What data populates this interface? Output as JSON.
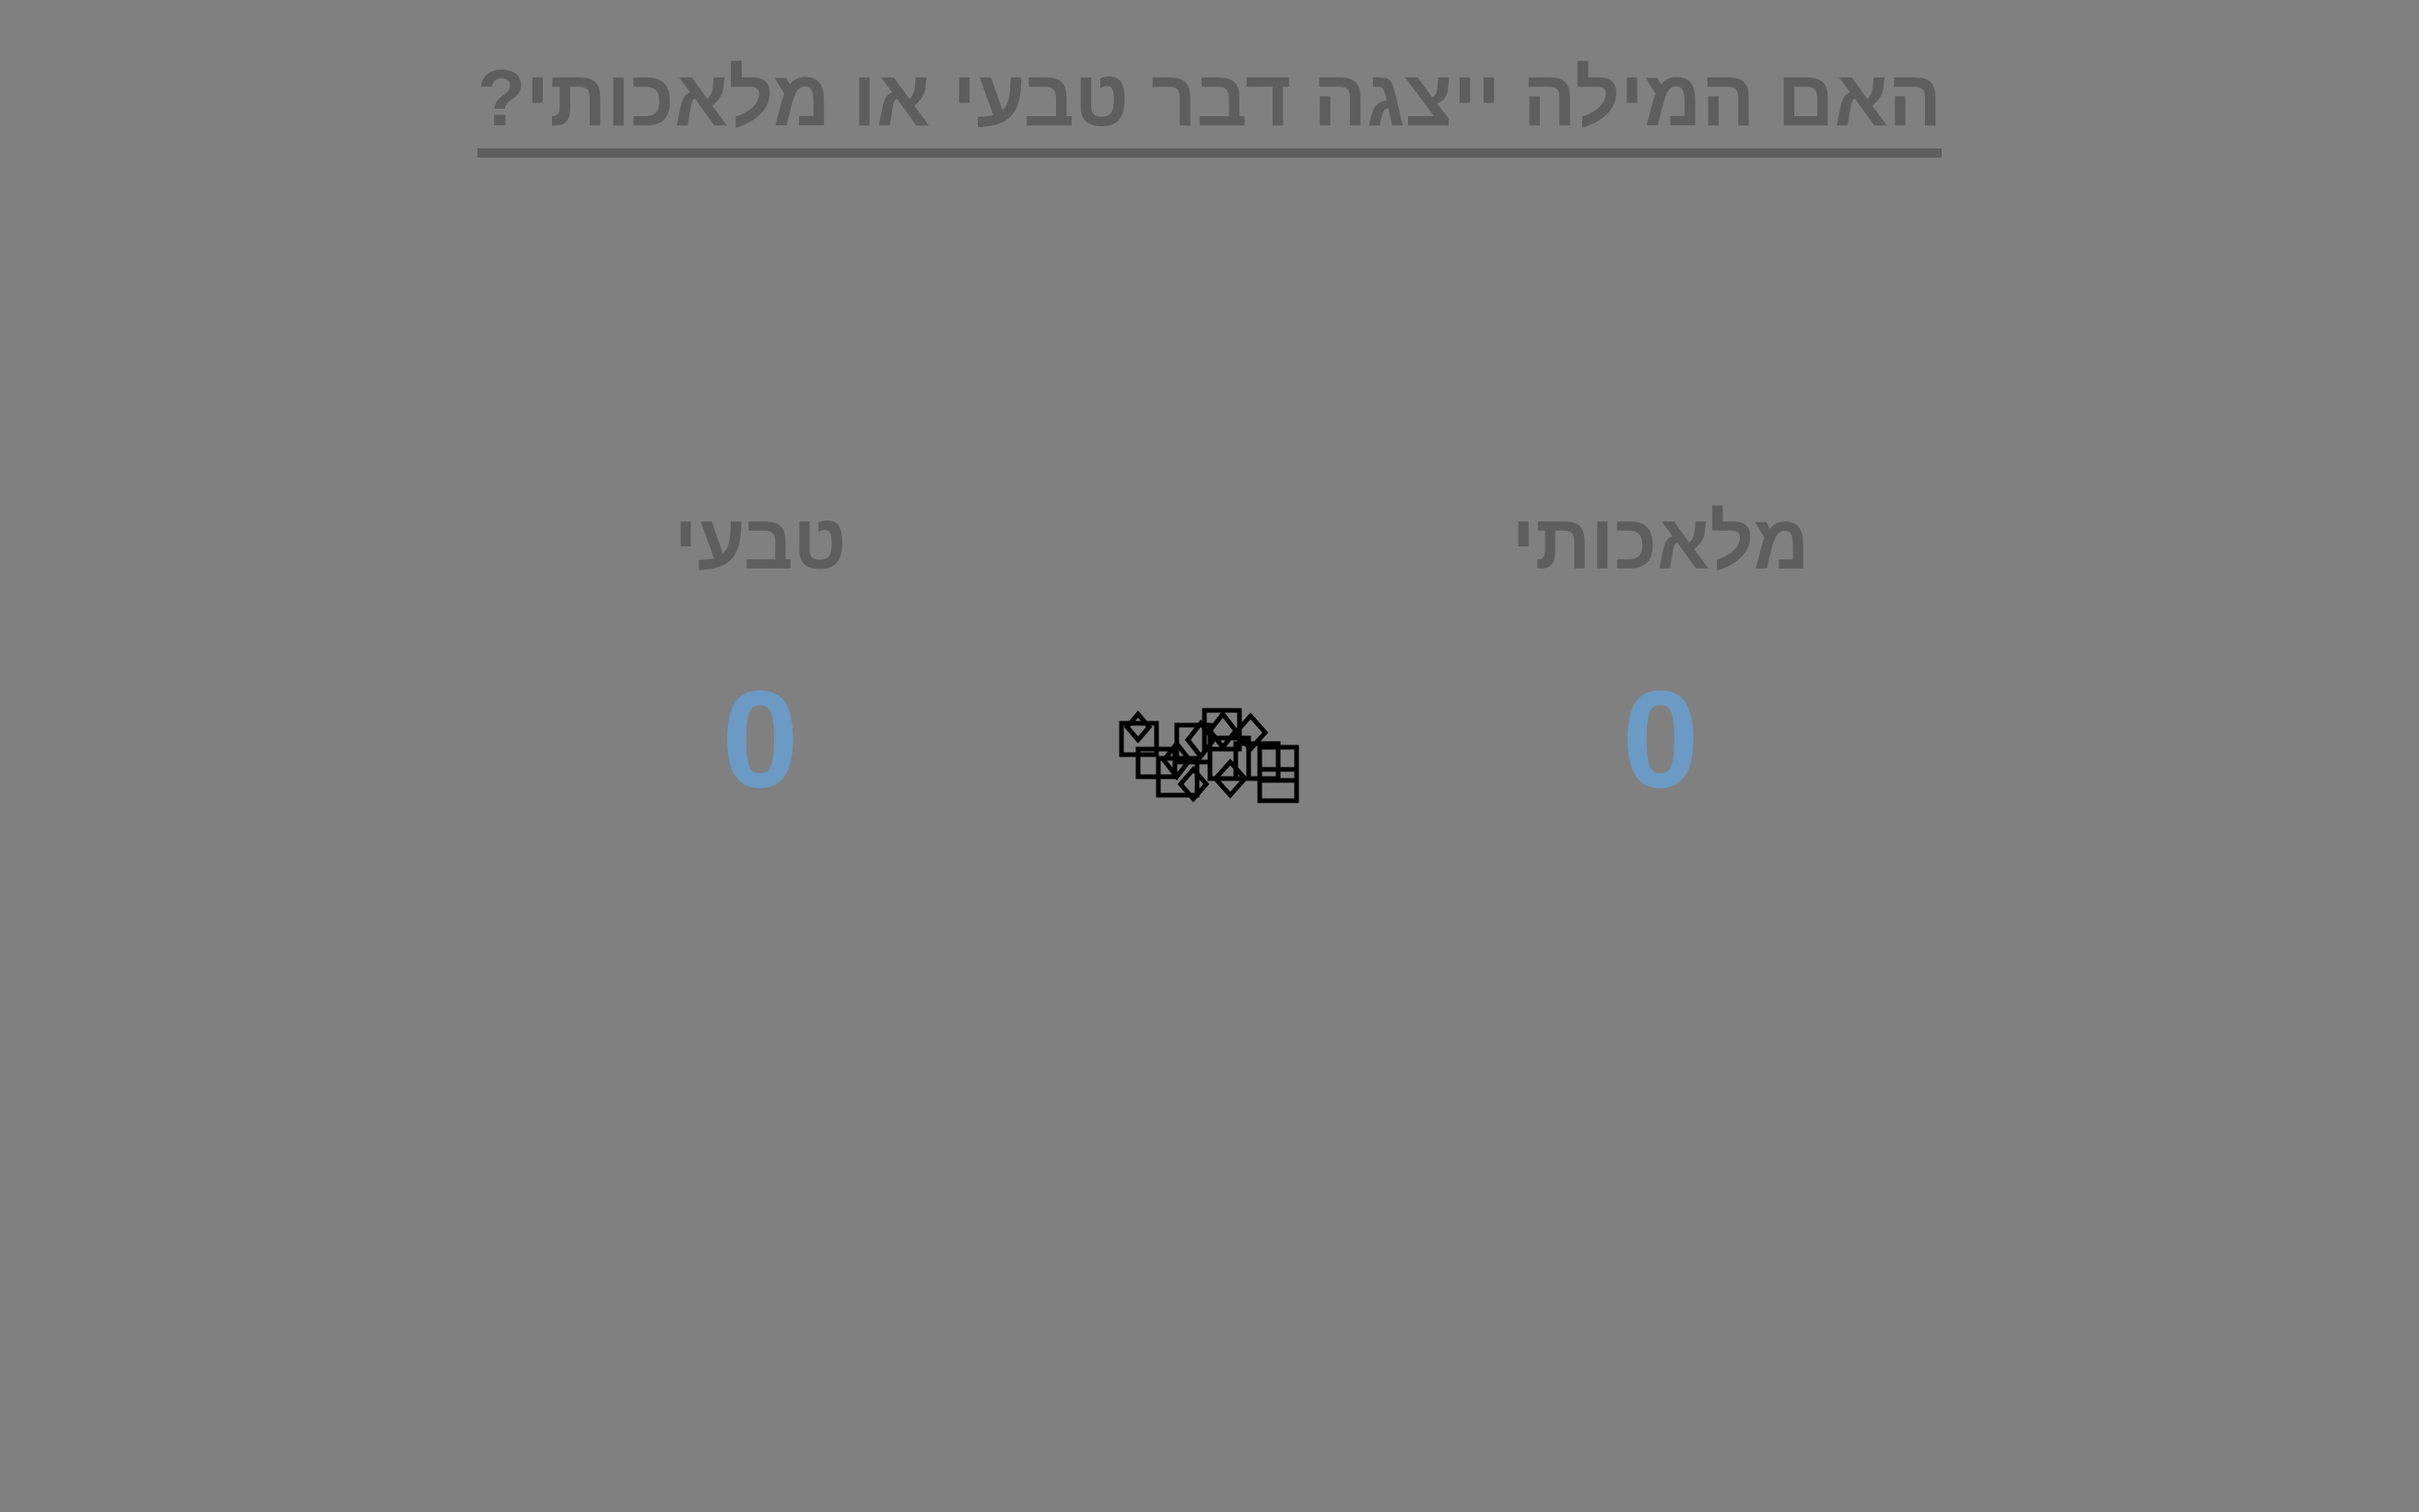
{
  "header": {
    "question": "האם המילה ייצגה דבר טבעי או מלאכותי?"
  },
  "categories": {
    "left": {
      "label": "טבעי",
      "count": "0"
    },
    "right": {
      "label": "מלאכותי",
      "count": "0"
    }
  },
  "stimulus": {
    "icon": "missing-glyph-boxes-icon",
    "description_color": "#000000"
  },
  "colors": {
    "background": "#808080",
    "text": "#5e5e5e",
    "count": "#6b9ac4"
  }
}
